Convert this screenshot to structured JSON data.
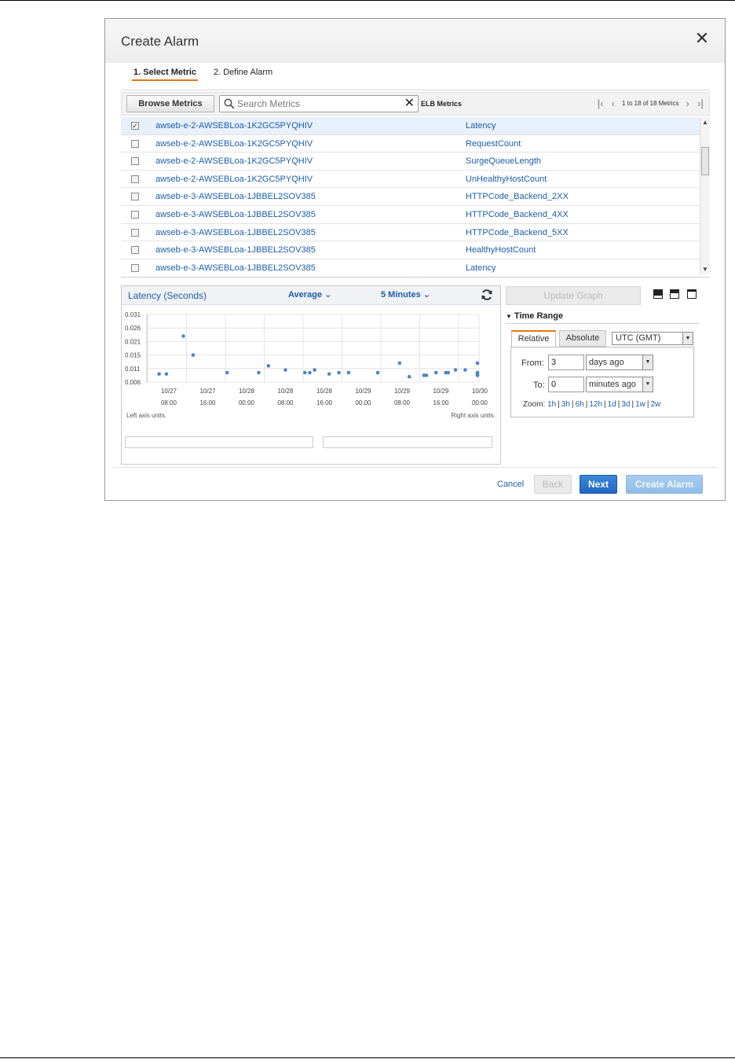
{
  "dialog": {
    "title": "Create Alarm",
    "close_icon": "close-icon"
  },
  "steps": [
    {
      "label": "1. Select Metric",
      "active": true
    },
    {
      "label": "2. Define Alarm",
      "active": false
    }
  ],
  "toolbar": {
    "browse_label": "Browse Metrics",
    "search_placeholder": "Search Metrics",
    "search_value": "",
    "clear_glyph": "✕",
    "category_label": "ELB Metrics",
    "pager_text": "1 to 18 of 18 Metrics"
  },
  "metrics": [
    {
      "name": "awseb-e-2-AWSEBLoa-1K2GC5PYQHIV",
      "metric": "Latency",
      "checked": true
    },
    {
      "name": "awseb-e-2-AWSEBLoa-1K2GC5PYQHIV",
      "metric": "RequestCount",
      "checked": false
    },
    {
      "name": "awseb-e-2-AWSEBLoa-1K2GC5PYQHIV",
      "metric": "SurgeQueueLength",
      "checked": false
    },
    {
      "name": "awseb-e-2-AWSEBLoa-1K2GC5PYQHIV",
      "metric": "UnHealthyHostCount",
      "checked": false
    },
    {
      "name": "awseb-e-3-AWSEBLoa-1JBBEL2SOV385",
      "metric": "HTTPCode_Backend_2XX",
      "checked": false
    },
    {
      "name": "awseb-e-3-AWSEBLoa-1JBBEL2SOV385",
      "metric": "HTTPCode_Backend_4XX",
      "checked": false
    },
    {
      "name": "awseb-e-3-AWSEBLoa-1JBBEL2SOV385",
      "metric": "HTTPCode_Backend_5XX",
      "checked": false
    },
    {
      "name": "awseb-e-3-AWSEBLoa-1JBBEL2SOV385",
      "metric": "HealthyHostCount",
      "checked": false
    },
    {
      "name": "awseb-e-3-AWSEBLoa-1JBBEL2SOV385",
      "metric": "Latency",
      "checked": false
    }
  ],
  "graph": {
    "title": "Latency (Seconds)",
    "statistic": "Average",
    "period": "5 Minutes",
    "left_axis_units": "Left axis units.",
    "right_axis_units": "Right axis units."
  },
  "chart_data": {
    "type": "scatter",
    "title": "Latency (Seconds)",
    "ylim": [
      0.006,
      0.031
    ],
    "yticks": [
      "0.031",
      "0.026",
      "0.021",
      "0.015",
      "0.011",
      "0.006"
    ],
    "xtick_labels": [
      [
        "10/27",
        "08:00"
      ],
      [
        "10/27",
        "16:00"
      ],
      [
        "10/28",
        "00:00"
      ],
      [
        "10/28",
        "08:00"
      ],
      [
        "10/28",
        "16:00"
      ],
      [
        "10/29",
        "00:00"
      ],
      [
        "10/29",
        "08:00"
      ],
      [
        "10/29",
        "16:00"
      ],
      [
        "10/30",
        "00:00"
      ]
    ],
    "x_hours_from_first_tick": [
      -2,
      3,
      5,
      -0.5,
      12,
      18.5,
      20.5,
      24,
      28,
      29,
      30,
      33,
      35,
      37,
      43,
      47.5,
      49.5,
      52.5,
      53,
      55,
      57,
      57.5,
      59,
      61,
      68,
      68.5,
      70,
      77,
      79.5
    ],
    "series": [
      {
        "values": [
          0.009,
          0.023,
          0.016,
          0.009,
          0.0095,
          0.0095,
          0.012,
          0.0105,
          0.0095,
          0.0095,
          0.0105,
          0.009,
          0.0095,
          0.0095,
          0.0095,
          0.013,
          0.008,
          0.0085,
          0.0085,
          0.0095,
          0.0095,
          0.0095,
          0.0105,
          0.0105,
          0.009,
          0.013,
          0.0085,
          0.0085,
          0.0095
        ]
      }
    ],
    "grid": true,
    "color": "#4a86c8"
  },
  "update_graph_label": "Update Graph",
  "time_range": {
    "header": "Time Range",
    "tabs": [
      "Relative",
      "Absolute"
    ],
    "timezone": "UTC (GMT)",
    "from_label": "From:",
    "from_value": "3",
    "from_unit": "days ago",
    "to_label": "To:",
    "to_value": "0",
    "to_unit": "minutes ago",
    "zoom_label": "Zoom:",
    "zoom_options": [
      "1h",
      "3h",
      "6h",
      "12h",
      "1d",
      "3d",
      "1w",
      "2w"
    ]
  },
  "footer": {
    "cancel": "Cancel",
    "back": "Back",
    "next": "Next",
    "create": "Create Alarm"
  }
}
